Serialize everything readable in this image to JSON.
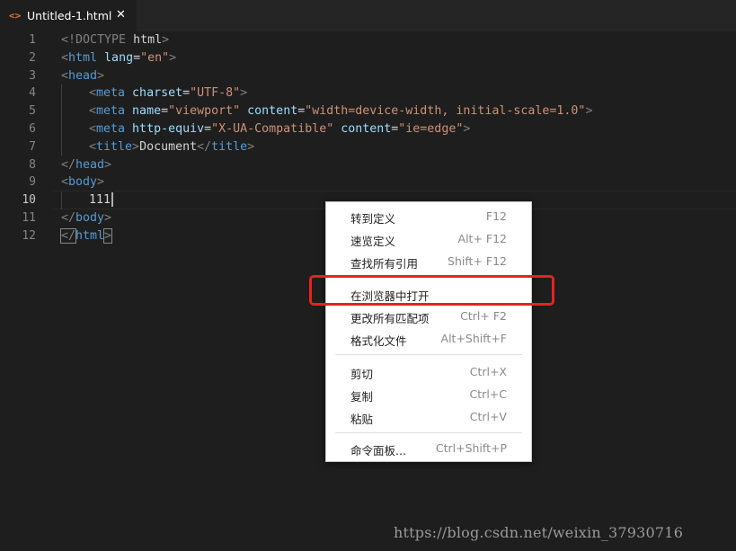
{
  "tab": {
    "icon": "<>",
    "title": "Untitled-1.html",
    "close": "✕"
  },
  "editor": {
    "line_numbers": [
      "1",
      "2",
      "3",
      "4",
      "5",
      "6",
      "7",
      "8",
      "9",
      "10",
      "11",
      "12"
    ],
    "active_line": "10",
    "tokens": {
      "l1": [
        "<!DOCTYPE",
        " html",
        ">"
      ],
      "l2": [
        "<",
        "html",
        " lang",
        "=",
        "\"en\"",
        ">"
      ],
      "l3": [
        "<",
        "head",
        ">"
      ],
      "l4": [
        "<",
        "meta",
        " charset",
        "=",
        "\"UTF-8\"",
        ">"
      ],
      "l5": [
        "<",
        "meta",
        " name",
        "=",
        "\"viewport\"",
        " content",
        "=",
        "\"width=device-width, initial-scale=1.0\"",
        ">"
      ],
      "l6": [
        "<",
        "meta",
        " http-equiv",
        "=",
        "\"X-UA-Compatible\"",
        " content",
        "=",
        "\"ie=edge\"",
        ">"
      ],
      "l7": [
        "<",
        "title",
        ">",
        "Document",
        "</",
        "title",
        ">"
      ],
      "l8": [
        "</",
        "head",
        ">"
      ],
      "l9": [
        "<",
        "body",
        ">"
      ],
      "l10": [
        "111"
      ],
      "l11": [
        "</",
        "body",
        ">"
      ],
      "l12": [
        "</",
        "html",
        ">"
      ]
    }
  },
  "context_menu": {
    "items": [
      {
        "label": "转到定义",
        "shortcut": "F12"
      },
      {
        "label": "速览定义",
        "shortcut": "Alt+ F12"
      },
      {
        "label": "查找所有引用",
        "shortcut": "Shift+ F12"
      },
      {
        "label": "在浏览器中打开",
        "shortcut": ""
      },
      {
        "label": "更改所有匹配项",
        "shortcut": "Ctrl+ F2"
      },
      {
        "label": "格式化文件",
        "shortcut": "Alt+Shift+F"
      },
      {
        "label": "剪切",
        "shortcut": "Ctrl+X"
      },
      {
        "label": "复制",
        "shortcut": "Ctrl+C"
      },
      {
        "label": "粘贴",
        "shortcut": "Ctrl+V"
      },
      {
        "label": "命令面板...",
        "shortcut": "Ctrl+Shift+P"
      }
    ]
  },
  "watermark": "https://blog.csdn.net/weixin_37930716",
  "colors": {
    "background": "#1e1e1e",
    "tag": "#569cd6",
    "attribute": "#9cdcfe",
    "string": "#ce9178",
    "punctuation": "#808080",
    "highlight": "#e8231b"
  }
}
